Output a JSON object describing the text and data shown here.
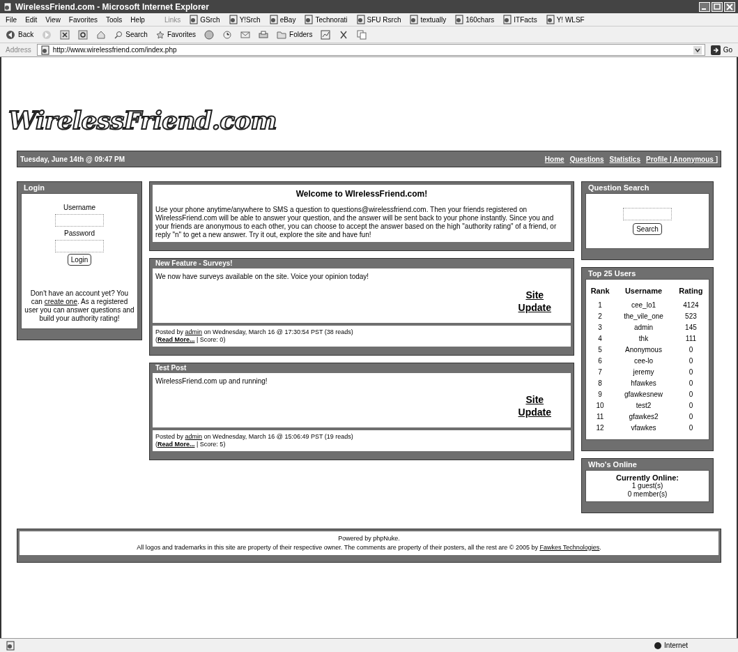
{
  "window": {
    "title": "WirelessFriend.com - Microsoft Internet Explorer"
  },
  "menu": [
    "File",
    "Edit",
    "View",
    "Favorites",
    "Tools",
    "Help"
  ],
  "links_bar": {
    "label": "Links",
    "items": [
      "GSrch",
      "Y!Srch",
      "eBay",
      "Technorati",
      "SFU Rsrch",
      "textually",
      "160chars",
      "ITFacts",
      "Y! WLSF"
    ]
  },
  "toolbar": {
    "back": "Back",
    "search": "Search",
    "favorites": "Favorites",
    "folders": "Folders"
  },
  "address": {
    "label": "Address",
    "url": "http://www.wirelessfriend.com/index.php",
    "go": "Go"
  },
  "site": {
    "logo": "WirelessFriend.com",
    "date": "Tuesday, June 14th @ 09:47 PM",
    "nav": [
      "Home",
      "Questions",
      "Statistics",
      "Profile | Anonymous ]"
    ]
  },
  "login": {
    "title": "Login",
    "username_label": "Username",
    "password_label": "Password",
    "button": "Login",
    "note_before": "Don't have an account yet? You can ",
    "note_link": "create one",
    "note_after": ". As a registered user you can answer questions and build your authority rating!"
  },
  "welcome": {
    "title": "Welcome to WIrelessFriend.com!",
    "body": "Use your phone anytime/anywhere to SMS a question to questions@wirelessfriend.com. Then your friends registered on WirelessFriend.com will be able to answer your question, and the answer will be sent back to your phone instantly. Since you and your friends are anonymous to each other, you can choose to accept the answer based on the high \"authority rating\" of a friend, or reply \"n\" to get a new answer. Try it out, explore the site and have fun!"
  },
  "posts": [
    {
      "title": "New Feature - Surveys!",
      "body": "We now have surveys available on the site. Voice your opinion today!",
      "topic": [
        "Site",
        "Update"
      ],
      "posted_by": "Posted by ",
      "author": "admin",
      "date": " on Wednesday, March 16 @ 17:30:54 PST (38 reads)",
      "open": "(",
      "read_more": "Read More...",
      "sep": " | ",
      "score": "Score: 0",
      "close": ")"
    },
    {
      "title": "Test Post",
      "body": "WirelessFriend.com up and running!",
      "topic": [
        "Site",
        "Update"
      ],
      "posted_by": "Posted by ",
      "author": "admin",
      "date": " on Wednesday, March 16 @ 15:06:49 PST (19 reads)",
      "open": "(",
      "read_more": "Read More...",
      "sep": " | ",
      "score": "Score: 5",
      "close": ")"
    }
  ],
  "search_block": {
    "title": "Question Search",
    "button": "Search"
  },
  "top_users": {
    "title": "Top 25 Users",
    "columns": [
      "Rank",
      "Username",
      "Rating"
    ],
    "rows": [
      [
        "1",
        "cee_lo1",
        "4124"
      ],
      [
        "2",
        "the_vile_one",
        "523"
      ],
      [
        "3",
        "admin",
        "145"
      ],
      [
        "4",
        "thk",
        "111"
      ],
      [
        "5",
        "Anonymous",
        "0"
      ],
      [
        "6",
        "cee-lo",
        "0"
      ],
      [
        "7",
        "jeremy",
        "0"
      ],
      [
        "8",
        "hfawkes",
        "0"
      ],
      [
        "9",
        "gfawkesnew",
        "0"
      ],
      [
        "10",
        "test2",
        "0"
      ],
      [
        "11",
        "gfawkes2",
        "0"
      ],
      [
        "12",
        "vfawkes",
        "0"
      ]
    ]
  },
  "online": {
    "title": "Who's Online",
    "heading": "Currently Online:",
    "lines": [
      "1 guest(s)",
      "0 member(s)"
    ]
  },
  "footer": {
    "powered": "Powered by phpNuke.",
    "text": "All logos and trademarks in this site are property of their respective owner. The comments are property of their posters, all the rest are © 2005 by ",
    "link": "Fawkes Technologies",
    "end": "."
  },
  "status_bar": {
    "zone": "Internet"
  }
}
